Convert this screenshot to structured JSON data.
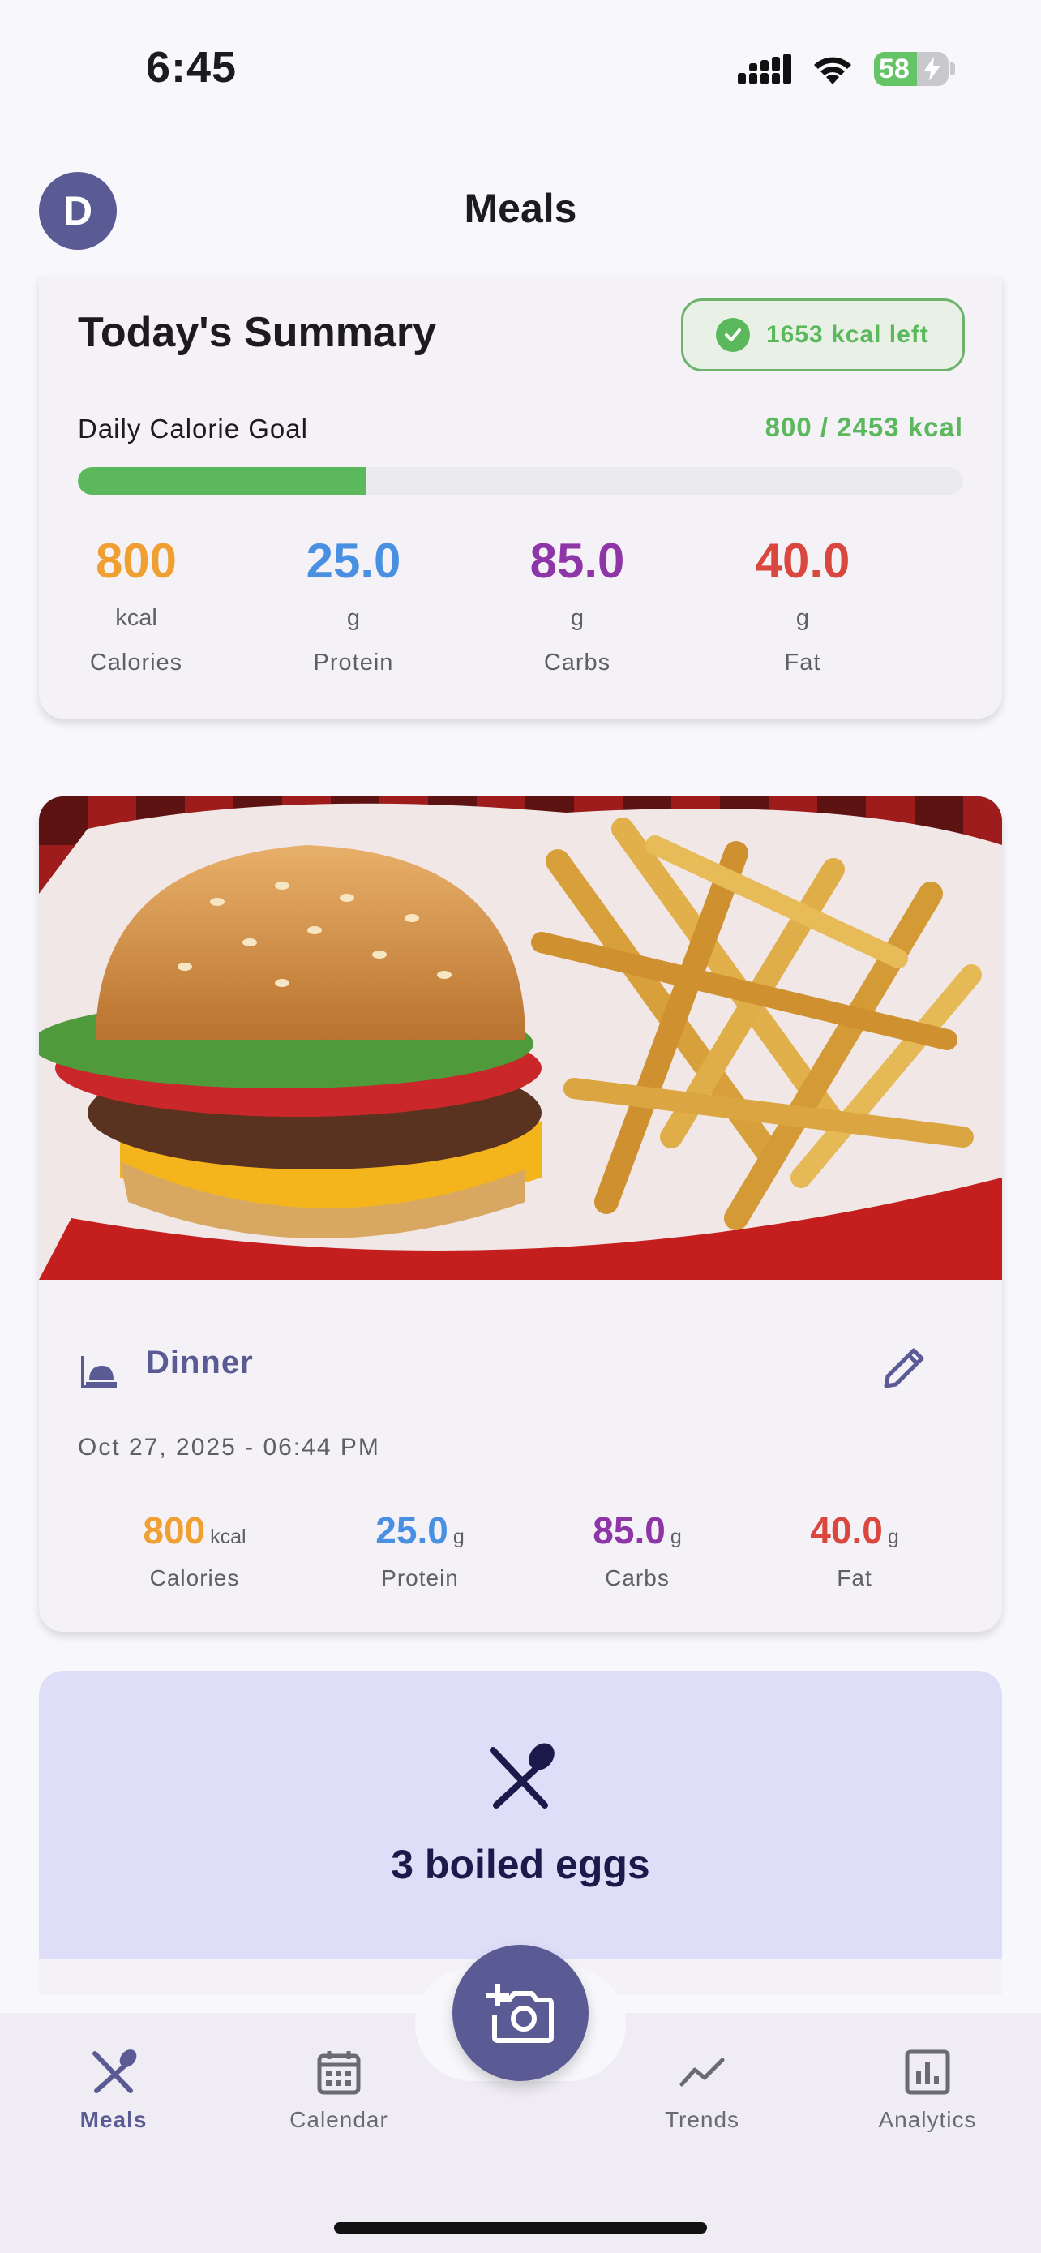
{
  "status_bar": {
    "time": "6:45",
    "battery": "58",
    "battery_level": 58
  },
  "header": {
    "avatar_initial": "D",
    "title": "Meals"
  },
  "summary": {
    "title": "Today's Summary",
    "badge": "1653 kcal left",
    "goal_label": "Daily Calorie Goal",
    "goal_value": "800 / 2453 kcal",
    "progress": 0.326,
    "macros": [
      {
        "value": "800",
        "unit": "kcal",
        "label": "Calories",
        "color": "#f0a033"
      },
      {
        "value": "25.0",
        "unit": "g",
        "label": "Protein",
        "color": "#4a90e2"
      },
      {
        "value": "85.0",
        "unit": "g",
        "label": "Carbs",
        "color": "#8e35a8"
      },
      {
        "value": "40.0",
        "unit": "g",
        "label": "Fat",
        "color": "#d9473f"
      }
    ]
  },
  "meal": {
    "type": "Dinner",
    "datetime": "Oct 27, 2025 - 06:44 PM",
    "photo": "burger-and-fries-photo",
    "macros": [
      {
        "value": "800",
        "unit": "kcal",
        "label": "Calories",
        "color": "#f0a033"
      },
      {
        "value": "25.0",
        "unit": "g",
        "label": "Protein",
        "color": "#4a90e2"
      },
      {
        "value": "85.0",
        "unit": "g",
        "label": "Carbs",
        "color": "#8e35a8"
      },
      {
        "value": "40.0",
        "unit": "g",
        "label": "Fat",
        "color": "#d9473f"
      }
    ]
  },
  "meal_2": {
    "title": "3 boiled eggs",
    "icon": "utensils-icon"
  },
  "nav": {
    "items": [
      {
        "label": "Meals",
        "icon": "utensils-icon",
        "active": true
      },
      {
        "label": "Calendar",
        "icon": "calendar-icon",
        "active": false
      },
      {
        "label": "Trends",
        "icon": "trend-line-icon",
        "active": false
      },
      {
        "label": "Analytics",
        "icon": "bar-chart-icon",
        "active": false
      }
    ],
    "fab_icon": "add-photo-camera-icon"
  },
  "colors": {
    "primary": "#5a5b95",
    "success": "#5cb85c",
    "background": "#f8f7fb"
  }
}
